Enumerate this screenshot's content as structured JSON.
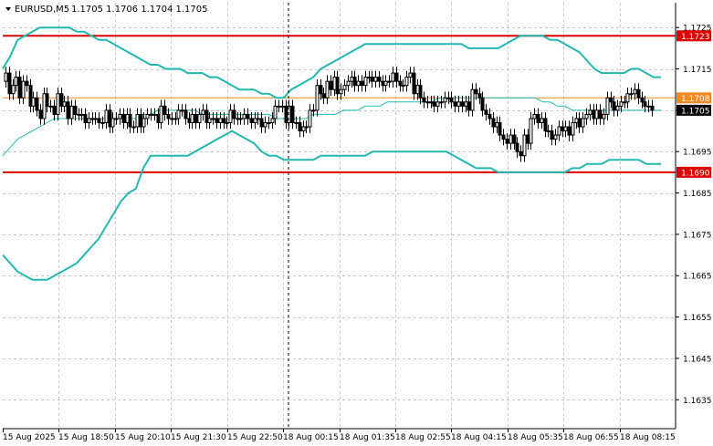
{
  "header": {
    "symbol_timeframe": "EURUSD,M5",
    "ohlc": "1.1705 1.1706 1.1704 1.1705"
  },
  "chart_data": {
    "type": "candlestick",
    "ylim": [
      1.1628,
      1.1731
    ],
    "price_ticks": [
      "1.1725",
      "1.1715",
      "1.1705",
      "1.1695",
      "1.1685",
      "1.1675",
      "1.1665",
      "1.1655",
      "1.1645",
      "1.1635"
    ],
    "time_ticks": [
      "15 Aug 2025",
      "15 Aug 18:50",
      "15 Aug 20:10",
      "15 Aug 21:30",
      "15 Aug 22:50",
      "18 Aug 00:15",
      "18 Aug 01:35",
      "18 Aug 02:55",
      "18 Aug 04:15",
      "18 Aug 05:35",
      "18 Aug 06:55",
      "18 Aug 08:15"
    ],
    "horizontal_levels": [
      {
        "label": "1.1723",
        "value": 1.1723,
        "color": "#dd0000"
      },
      {
        "label": "1.1690",
        "value": 1.169,
        "color": "#dd0000"
      },
      {
        "label": "1.1708",
        "value": 1.1708,
        "color": "#f08a24"
      }
    ],
    "current_price": {
      "label": "1.1705",
      "value": 1.1705
    },
    "closes": [
      1.1714,
      1.1709,
      1.1711,
      1.1713,
      1.1708,
      1.1712,
      1.1711,
      1.1706,
      1.1708,
      1.1705,
      1.1703,
      1.1709,
      1.1706,
      1.1706,
      1.1704,
      1.1709,
      1.1706,
      1.1707,
      1.1703,
      1.1706,
      1.1704,
      1.1704,
      1.1704,
      1.1702,
      1.1703,
      1.1703,
      1.1703,
      1.1702,
      1.1702,
      1.1705,
      1.1701,
      1.1703,
      1.1703,
      1.1704,
      1.1702,
      1.1704,
      1.1701,
      1.1701,
      1.1704,
      1.1701,
      1.1703,
      1.1704,
      1.1704,
      1.1704,
      1.1702,
      1.1706,
      1.1704,
      1.1703,
      1.1703,
      1.1703,
      1.1705,
      1.1705,
      1.1703,
      1.1702,
      1.1704,
      1.1702,
      1.1704,
      1.1705,
      1.1702,
      1.1703,
      1.1703,
      1.1702,
      1.1703,
      1.1702,
      1.1702,
      1.1705,
      1.1703,
      1.1703,
      1.1703,
      1.1704,
      1.1703,
      1.1702,
      1.1703,
      1.1703,
      1.1701,
      1.1702,
      1.1702,
      1.1703,
      1.1706,
      1.1706,
      1.1706,
      1.1702,
      1.1706,
      1.1702,
      1.1702,
      1.17,
      1.1701,
      1.1701,
      1.1705,
      1.1705,
      1.1711,
      1.1709,
      1.1708,
      1.1712,
      1.171,
      1.1713,
      1.1709,
      1.171,
      1.1711,
      1.1712,
      1.1713,
      1.1711,
      1.1712,
      1.1711,
      1.1713,
      1.1713,
      1.1712,
      1.1713,
      1.1712,
      1.1711,
      1.1712,
      1.1712,
      1.1714,
      1.1712,
      1.1711,
      1.1711,
      1.1713,
      1.1714,
      1.1709,
      1.1711,
      1.1708,
      1.1707,
      1.1707,
      1.1707,
      1.1706,
      1.1707,
      1.1707,
      1.1708,
      1.1708,
      1.1707,
      1.1706,
      1.1707,
      1.1706,
      1.1707,
      1.1705,
      1.171,
      1.1709,
      1.1708,
      1.1705,
      1.1704,
      1.1703,
      1.1701,
      1.1702,
      1.1699,
      1.1698,
      1.1697,
      1.1699,
      1.1697,
      1.1695,
      1.1694,
      1.1699,
      1.1697,
      1.1703,
      1.1704,
      1.1702,
      1.1703,
      1.17,
      1.17,
      1.1698,
      1.1699,
      1.1701,
      1.17,
      1.1701,
      1.1699,
      1.1702,
      1.1703,
      1.1701,
      1.1703,
      1.1704,
      1.1705,
      1.1703,
      1.1705,
      1.1703,
      1.1704,
      1.1708,
      1.1707,
      1.1705,
      1.1706,
      1.1707,
      1.1707,
      1.1709,
      1.1709,
      1.171,
      1.1708,
      1.1707,
      1.1706,
      1.1706,
      1.1705
    ],
    "bollinger": {
      "upper": [
        1.1715,
        1.1718,
        1.1722,
        1.1723,
        1.1724,
        1.1725,
        1.1725,
        1.1725,
        1.1725,
        1.1725,
        1.1724,
        1.1724,
        1.1723,
        1.1722,
        1.1722,
        1.1721,
        1.172,
        1.1719,
        1.1718,
        1.1717,
        1.1716,
        1.1716,
        1.1715,
        1.1715,
        1.1715,
        1.1714,
        1.1714,
        1.1714,
        1.1713,
        1.1713,
        1.1712,
        1.1711,
        1.171,
        1.171,
        1.171,
        1.1709,
        1.1709,
        1.1708,
        1.1708,
        1.171,
        1.1711,
        1.1712,
        1.1713,
        1.1715,
        1.1716,
        1.1717,
        1.1718,
        1.1719,
        1.172,
        1.1721,
        1.1721,
        1.1721,
        1.1721,
        1.1721,
        1.1721,
        1.1721,
        1.1721,
        1.1721,
        1.1721,
        1.1721,
        1.1721,
        1.1721,
        1.1721,
        1.172,
        1.172,
        1.172,
        1.172,
        1.172,
        1.1721,
        1.1722,
        1.1723,
        1.1723,
        1.1723,
        1.1723,
        1.1722,
        1.1722,
        1.1721,
        1.172,
        1.1719,
        1.1717,
        1.1715,
        1.1714,
        1.1714,
        1.1714,
        1.1714,
        1.1715,
        1.1715,
        1.1714,
        1.1713,
        1.1713
      ],
      "middle": [
        1.1694,
        1.1696,
        1.1698,
        1.1699,
        1.17,
        1.1701,
        1.1702,
        1.1703,
        1.1703,
        1.1703,
        1.1703,
        1.1703,
        1.1703,
        1.1703,
        1.1703,
        1.1703,
        1.1703,
        1.1703,
        1.1703,
        1.1704,
        1.1704,
        1.1705,
        1.1705,
        1.1705,
        1.1705,
        1.1705,
        1.1705,
        1.1704,
        1.1704,
        1.1704,
        1.1704,
        1.1704,
        1.1704,
        1.1704,
        1.1704,
        1.1704,
        1.1704,
        1.1703,
        1.1703,
        1.1703,
        1.1703,
        1.1703,
        1.1704,
        1.1704,
        1.1704,
        1.1704,
        1.1705,
        1.1705,
        1.1705,
        1.1706,
        1.1706,
        1.1706,
        1.1707,
        1.1707,
        1.1707,
        1.1707,
        1.1707,
        1.1707,
        1.1707,
        1.1708,
        1.1708,
        1.1708,
        1.1708,
        1.1708,
        1.1708,
        1.1708,
        1.1708,
        1.1708,
        1.1708,
        1.1708,
        1.1708,
        1.1708,
        1.1708,
        1.1707,
        1.1707,
        1.1706,
        1.1706,
        1.1705,
        1.1705,
        1.1705,
        1.1705,
        1.1705,
        1.1705,
        1.1705,
        1.1705,
        1.1705,
        1.1705,
        1.1705,
        1.1705,
        1.1705
      ],
      "lower": [
        1.167,
        1.1668,
        1.1666,
        1.1665,
        1.1664,
        1.1664,
        1.1664,
        1.1665,
        1.1666,
        1.1667,
        1.1668,
        1.167,
        1.1672,
        1.1674,
        1.1677,
        1.168,
        1.1683,
        1.1685,
        1.1686,
        1.1691,
        1.1694,
        1.1694,
        1.1694,
        1.1694,
        1.1694,
        1.1694,
        1.1695,
        1.1696,
        1.1697,
        1.1698,
        1.1699,
        1.17,
        1.1699,
        1.1698,
        1.1697,
        1.1695,
        1.1694,
        1.1694,
        1.1693,
        1.1693,
        1.1693,
        1.1693,
        1.1693,
        1.1694,
        1.1694,
        1.1694,
        1.1694,
        1.1694,
        1.1694,
        1.1694,
        1.1695,
        1.1695,
        1.1695,
        1.1695,
        1.1695,
        1.1695,
        1.1695,
        1.1695,
        1.1695,
        1.1695,
        1.1695,
        1.1694,
        1.1693,
        1.1692,
        1.1691,
        1.1691,
        1.1691,
        1.169,
        1.169,
        1.169,
        1.169,
        1.169,
        1.169,
        1.169,
        1.169,
        1.169,
        1.169,
        1.1691,
        1.1691,
        1.1692,
        1.1692,
        1.1692,
        1.1693,
        1.1693,
        1.1693,
        1.1693,
        1.1693,
        1.1692,
        1.1692,
        1.1692
      ]
    }
  }
}
